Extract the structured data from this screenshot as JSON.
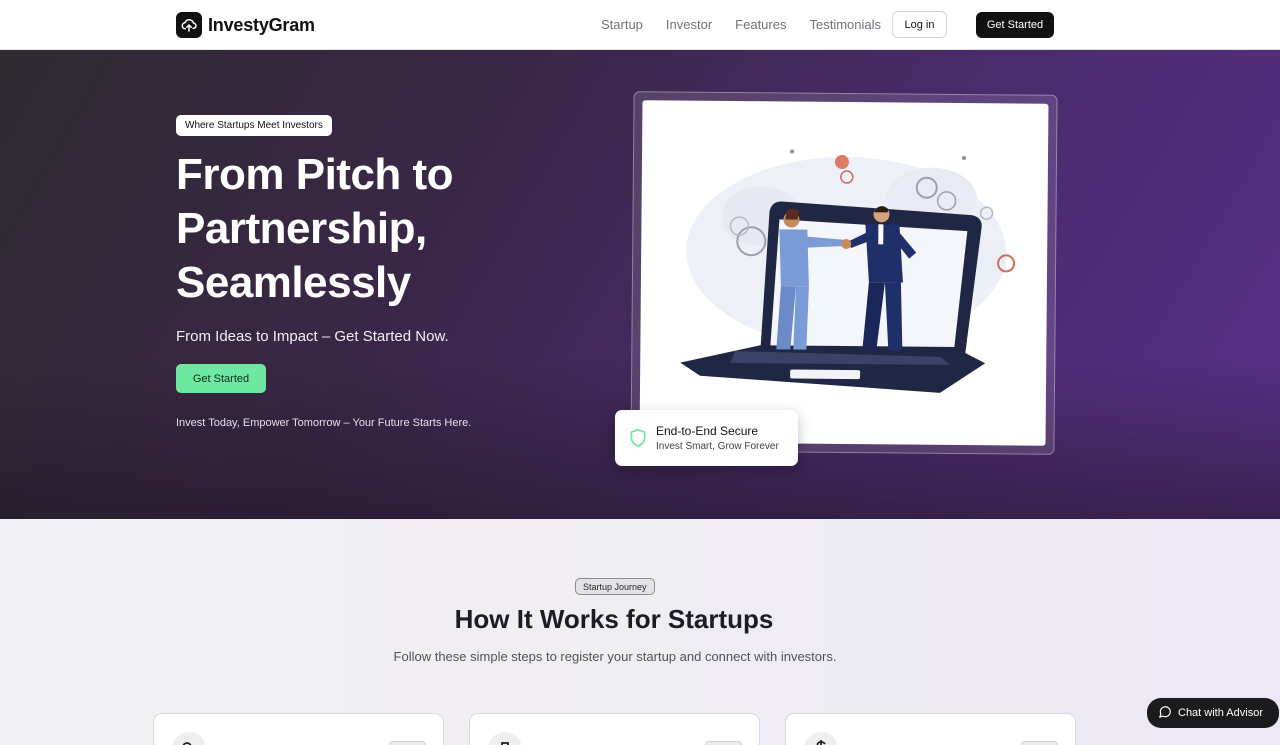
{
  "nav": {
    "brand": "InvestyGram",
    "links": [
      "Startup",
      "Investor",
      "Features",
      "Testimonials"
    ],
    "login_label": "Log in",
    "cta_label": "Get Started"
  },
  "hero": {
    "badge": "Where Startups Meet Investors",
    "title": "From Pitch to Partnership, Seamlessly",
    "subtitle": "From Ideas to Impact – Get Started Now.",
    "cta_label": "Get Started",
    "tagline": "Invest Today, Empower Tomorrow – Your Future Starts Here."
  },
  "secure_card": {
    "title": "End-to-End Secure",
    "subtitle": "Invest Smart, Grow Forever"
  },
  "how": {
    "badge": "Startup Journey",
    "title": "How It Works for Startups",
    "subtitle": "Follow these simple steps to register your startup and connect with investors."
  },
  "chat": {
    "label": "Chat with Advisor"
  },
  "icons": {
    "brand": "upload-cloud-icon",
    "secure": "shield-icon",
    "card1": "user-plus-icon",
    "card2": "briefcase-icon",
    "card3": "dollar-icon",
    "chat": "message-circle-icon"
  },
  "colors": {
    "accent_green": "#6ee7a0",
    "hero_gradient_end": "#5a2f8a",
    "dark": "#111111"
  }
}
